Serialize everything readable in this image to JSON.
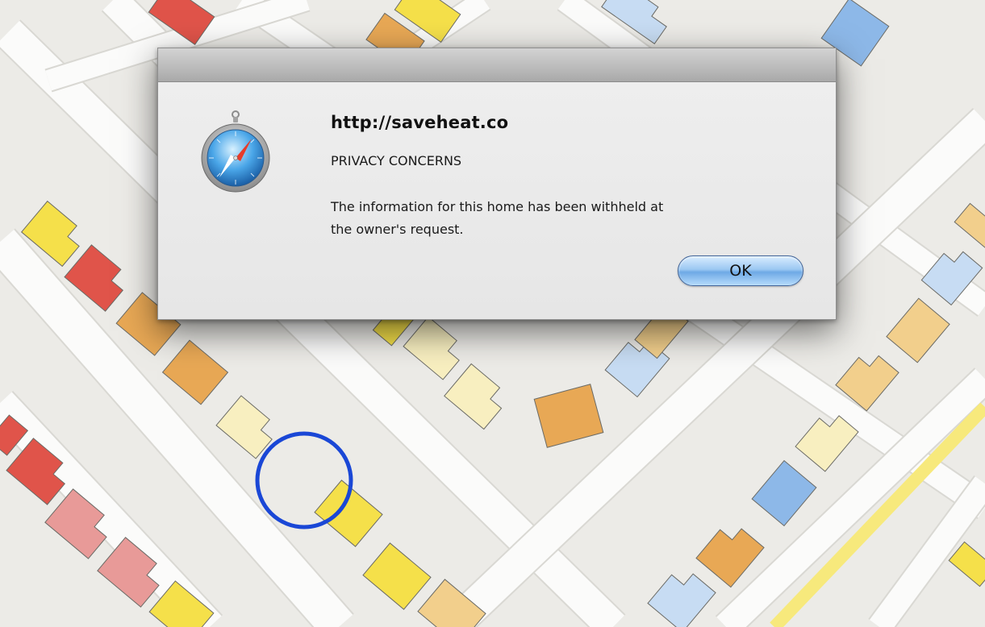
{
  "dialog": {
    "url": "http://saveheat.co",
    "heading": "PRIVACY CONCERNS",
    "message": "The information for this home has been withheld at the owner's request.",
    "ok_label": "OK",
    "icon": "safari-compass-icon"
  },
  "map": {
    "selection_marker": "circle",
    "marker_color": "#1a47d6"
  },
  "colors": {
    "red": "#e0544a",
    "pink": "#e89a98",
    "orange": "#e8a855",
    "light_orange": "#f2cf8c",
    "yellow": "#f5e04a",
    "pale_yellow": "#f8efc0",
    "light_blue": "#c7dcf3",
    "blue": "#8db8e8"
  }
}
